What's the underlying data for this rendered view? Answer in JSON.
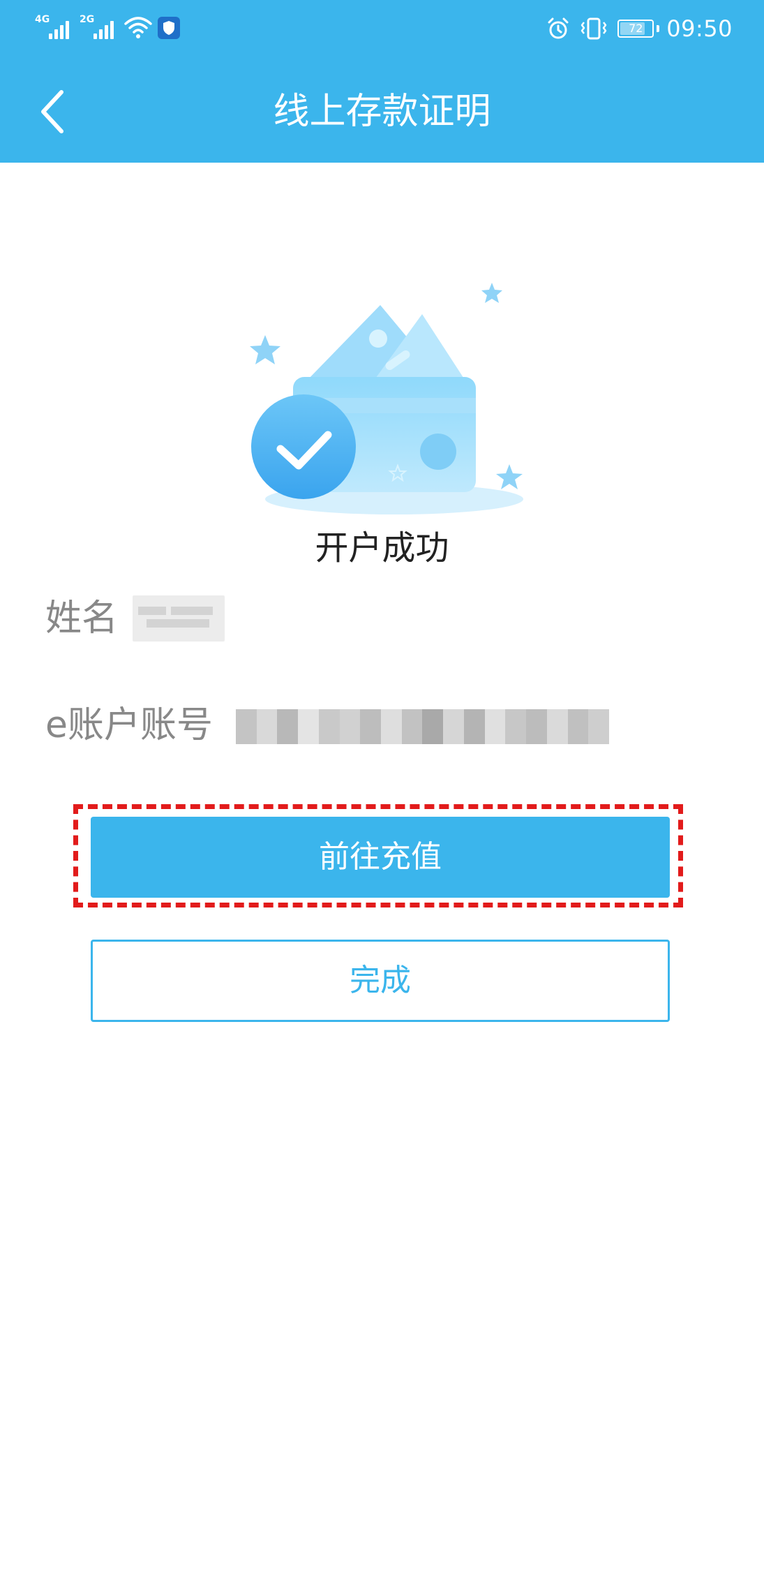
{
  "status_bar": {
    "network1_label": "4G",
    "network2_label": "2G",
    "battery_level": "72",
    "time": "09:50"
  },
  "header": {
    "title": "线上存款证明"
  },
  "result": {
    "message": "开户成功"
  },
  "info": {
    "name_label": "姓名",
    "account_label": "e账户账号"
  },
  "actions": {
    "recharge_label": "前往充值",
    "done_label": "完成"
  },
  "colors": {
    "brand": "#3bb5ec",
    "highlight": "#e21b1b"
  }
}
